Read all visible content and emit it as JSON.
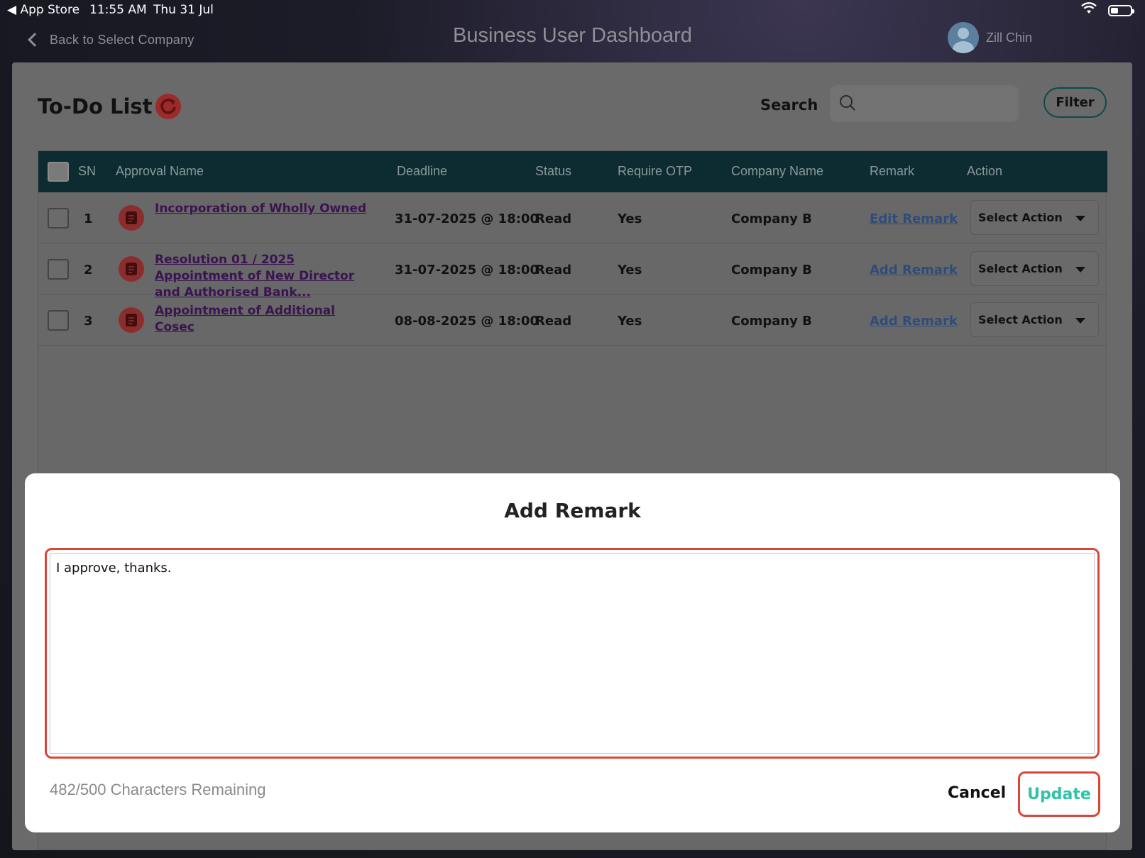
{
  "status_bar": {
    "back_app": "◀ App Store",
    "time": "11:55 AM",
    "date": "Thu 31 Jul"
  },
  "header": {
    "back_label": "Back to Select Company",
    "title": "Business User Dashboard",
    "user_name": "Zill Chin"
  },
  "todo": {
    "title": "To-Do List",
    "search_label": "Search",
    "search_placeholder": "",
    "filter_label": "Filter",
    "columns": [
      "SN",
      "Approval Name",
      "Deadline",
      "Status",
      "Require OTP",
      "Company Name",
      "Remark",
      "Action"
    ],
    "rows": [
      {
        "sn": "1",
        "name": "Incorporation of Wholly Owned",
        "deadline": "31-07-2025 @ 18:00",
        "status": "Read",
        "otp": "Yes",
        "company": "Company B",
        "remark": "Edit Remark",
        "action": "Select Action"
      },
      {
        "sn": "2",
        "name": "Resolution 01 / 2025 Appointment of New Director and Authorised Bank...",
        "deadline": "31-07-2025 @ 18:00",
        "status": "Read",
        "otp": "Yes",
        "company": "Company B",
        "remark": "Add Remark",
        "action": "Select Action"
      },
      {
        "sn": "3",
        "name": "Appointment of Additional Cosec",
        "deadline": "08-08-2025 @ 18:00",
        "status": "Read",
        "otp": "Yes",
        "company": "Company B",
        "remark": "Add Remark",
        "action": "Select Action"
      }
    ]
  },
  "modal": {
    "title": "Add Remark",
    "remark_value": "I approve, thanks.",
    "chars_remaining": "482/500 Characters Remaining",
    "cancel_label": "Cancel",
    "update_label": "Update"
  },
  "colors": {
    "table_header": "#0c2c32",
    "accent_teal": "#2ec3a8",
    "highlight_red": "#d9473a",
    "doc_icon_red": "#8d2c2c"
  },
  "icons": [
    "back-chevron-icon",
    "avatar-icon",
    "refresh-icon",
    "search-icon",
    "document-icon",
    "dropdown-caret-icon",
    "wifi-icon",
    "battery-icon"
  ]
}
